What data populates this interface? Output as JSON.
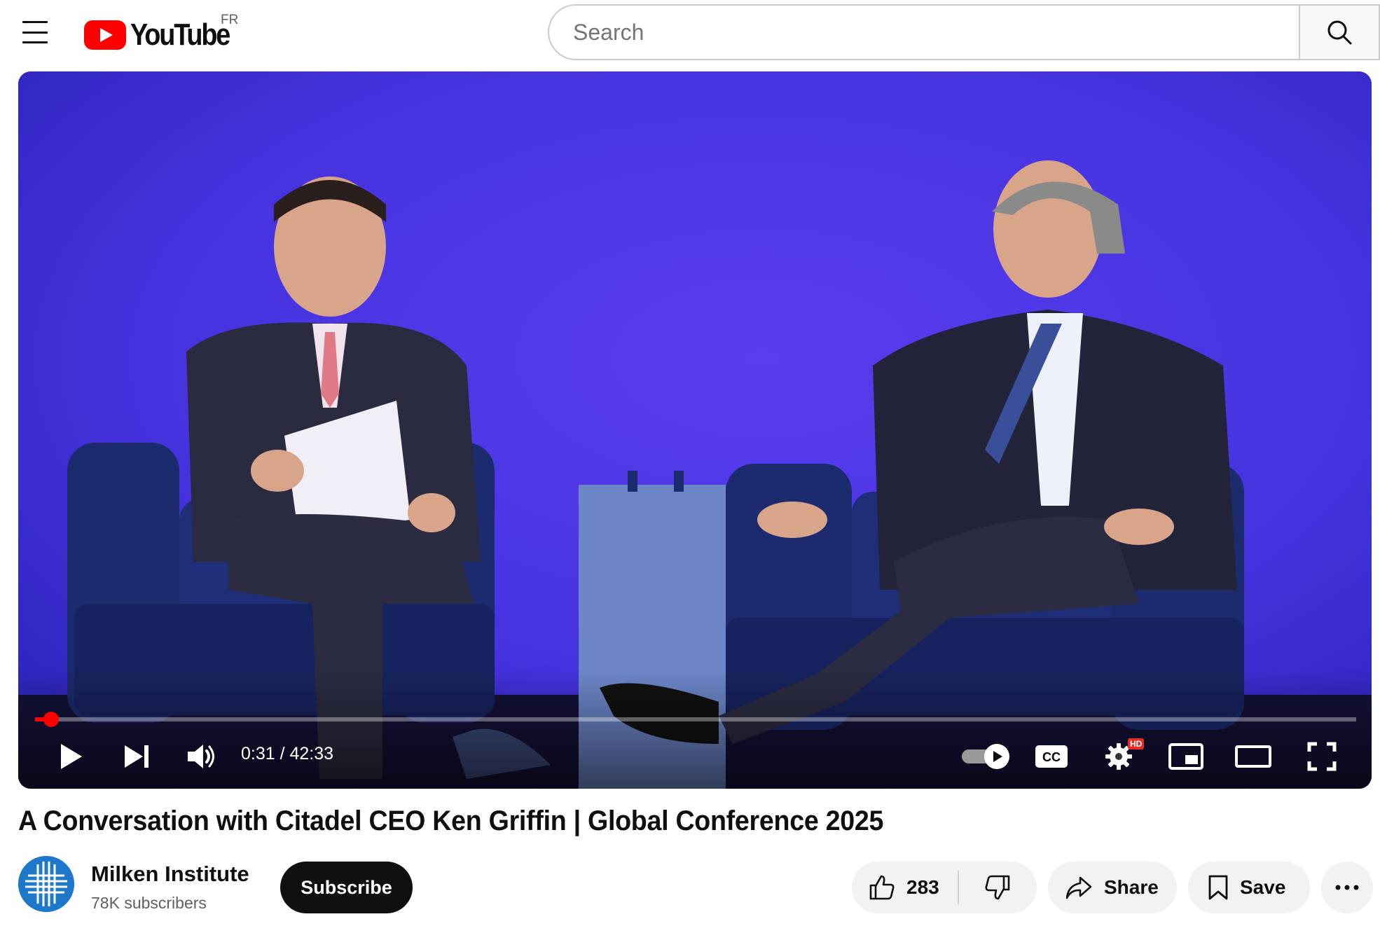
{
  "header": {
    "logo_text": "YouTube",
    "country_code": "FR",
    "search_placeholder": "Search"
  },
  "player": {
    "current_time": "0:31",
    "duration": "42:33",
    "time_display": "0:31 / 42:33",
    "progress_fraction": 0.012,
    "autoplay_on": true,
    "quality_badge": "HD"
  },
  "video": {
    "title": "A Conversation with Citadel CEO Ken Griffin | Global Conference 2025"
  },
  "channel": {
    "name": "Milken Institute",
    "subscribers": "78K subscribers",
    "subscribe_label": "Subscribe"
  },
  "actions": {
    "like_count": "283",
    "share_label": "Share",
    "save_label": "Save"
  },
  "colors": {
    "brand_red": "#ff0000",
    "stage_background": "#3a2fd0",
    "channel_avatar": "#1d78c9"
  }
}
